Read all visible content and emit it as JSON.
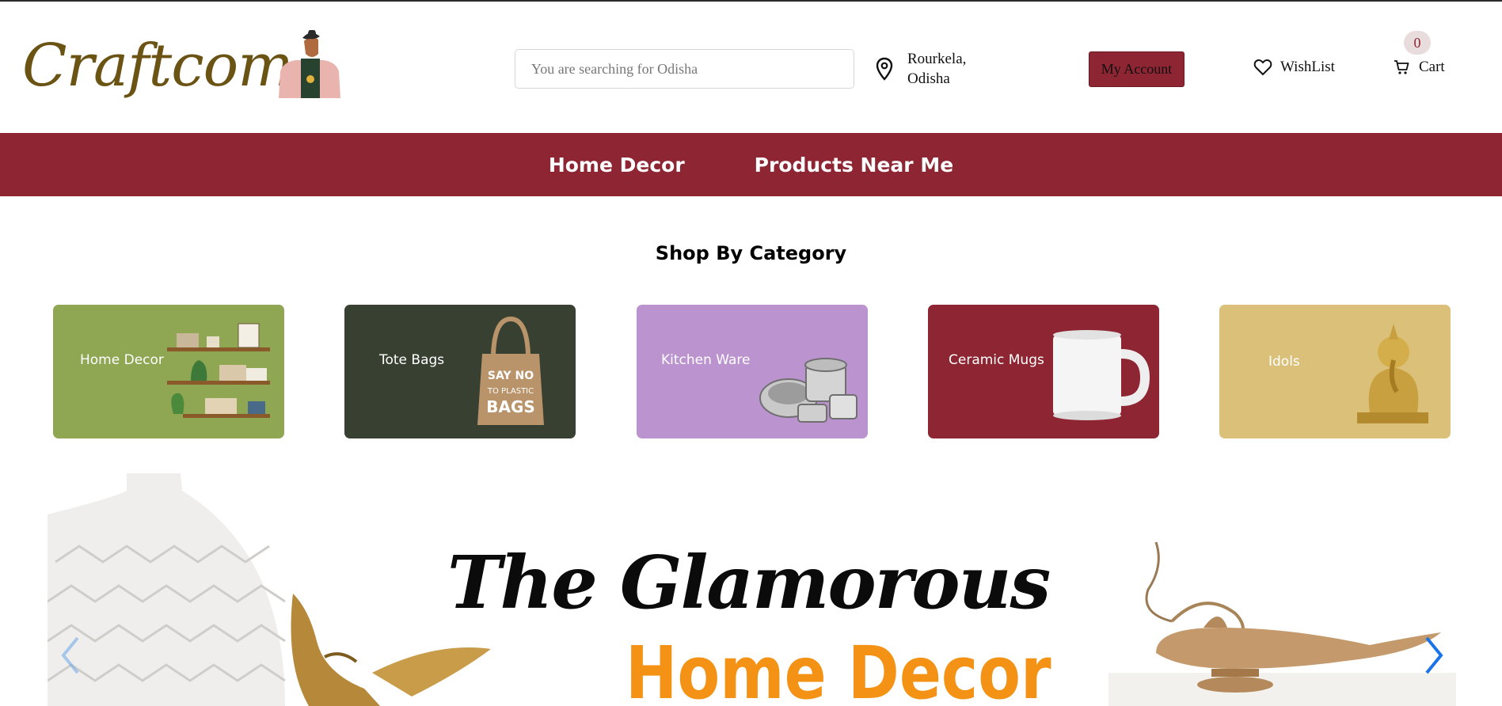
{
  "header": {
    "logo_text": "Craftcom",
    "search": {
      "placeholder": "You are searching for Odisha"
    },
    "location": {
      "line1": "Rourkela,",
      "line2": "Odisha"
    },
    "account_label": "My Account",
    "wishlist_label": "WishList",
    "cart_label": "Cart",
    "cart_count": "0"
  },
  "nav": {
    "items": [
      {
        "label": "Home Decor"
      },
      {
        "label": "Products Near Me"
      }
    ]
  },
  "categories": {
    "title": "Shop By Category",
    "items": [
      {
        "label": "Home Decor",
        "color": "#8fa653"
      },
      {
        "label": "Tote Bags",
        "color": "#384131"
      },
      {
        "label": "Kitchen Ware",
        "color": "#bb93cf"
      },
      {
        "label": "Ceramic Mugs",
        "color": "#8e2533"
      },
      {
        "label": "Idols",
        "color": "#dbc07a"
      }
    ]
  },
  "banner": {
    "line1": "The Glamorous",
    "line2": "Home Decor"
  },
  "colors": {
    "brand": "#8e2533",
    "logo": "#6b5314",
    "banner_accent": "#f39214",
    "slider_arrow": "#1a73e8"
  },
  "icons": {
    "location": "map-pin-icon",
    "wishlist": "heart-icon",
    "cart": "cart-icon",
    "prev": "chevron-left-icon",
    "next": "chevron-right-icon"
  }
}
